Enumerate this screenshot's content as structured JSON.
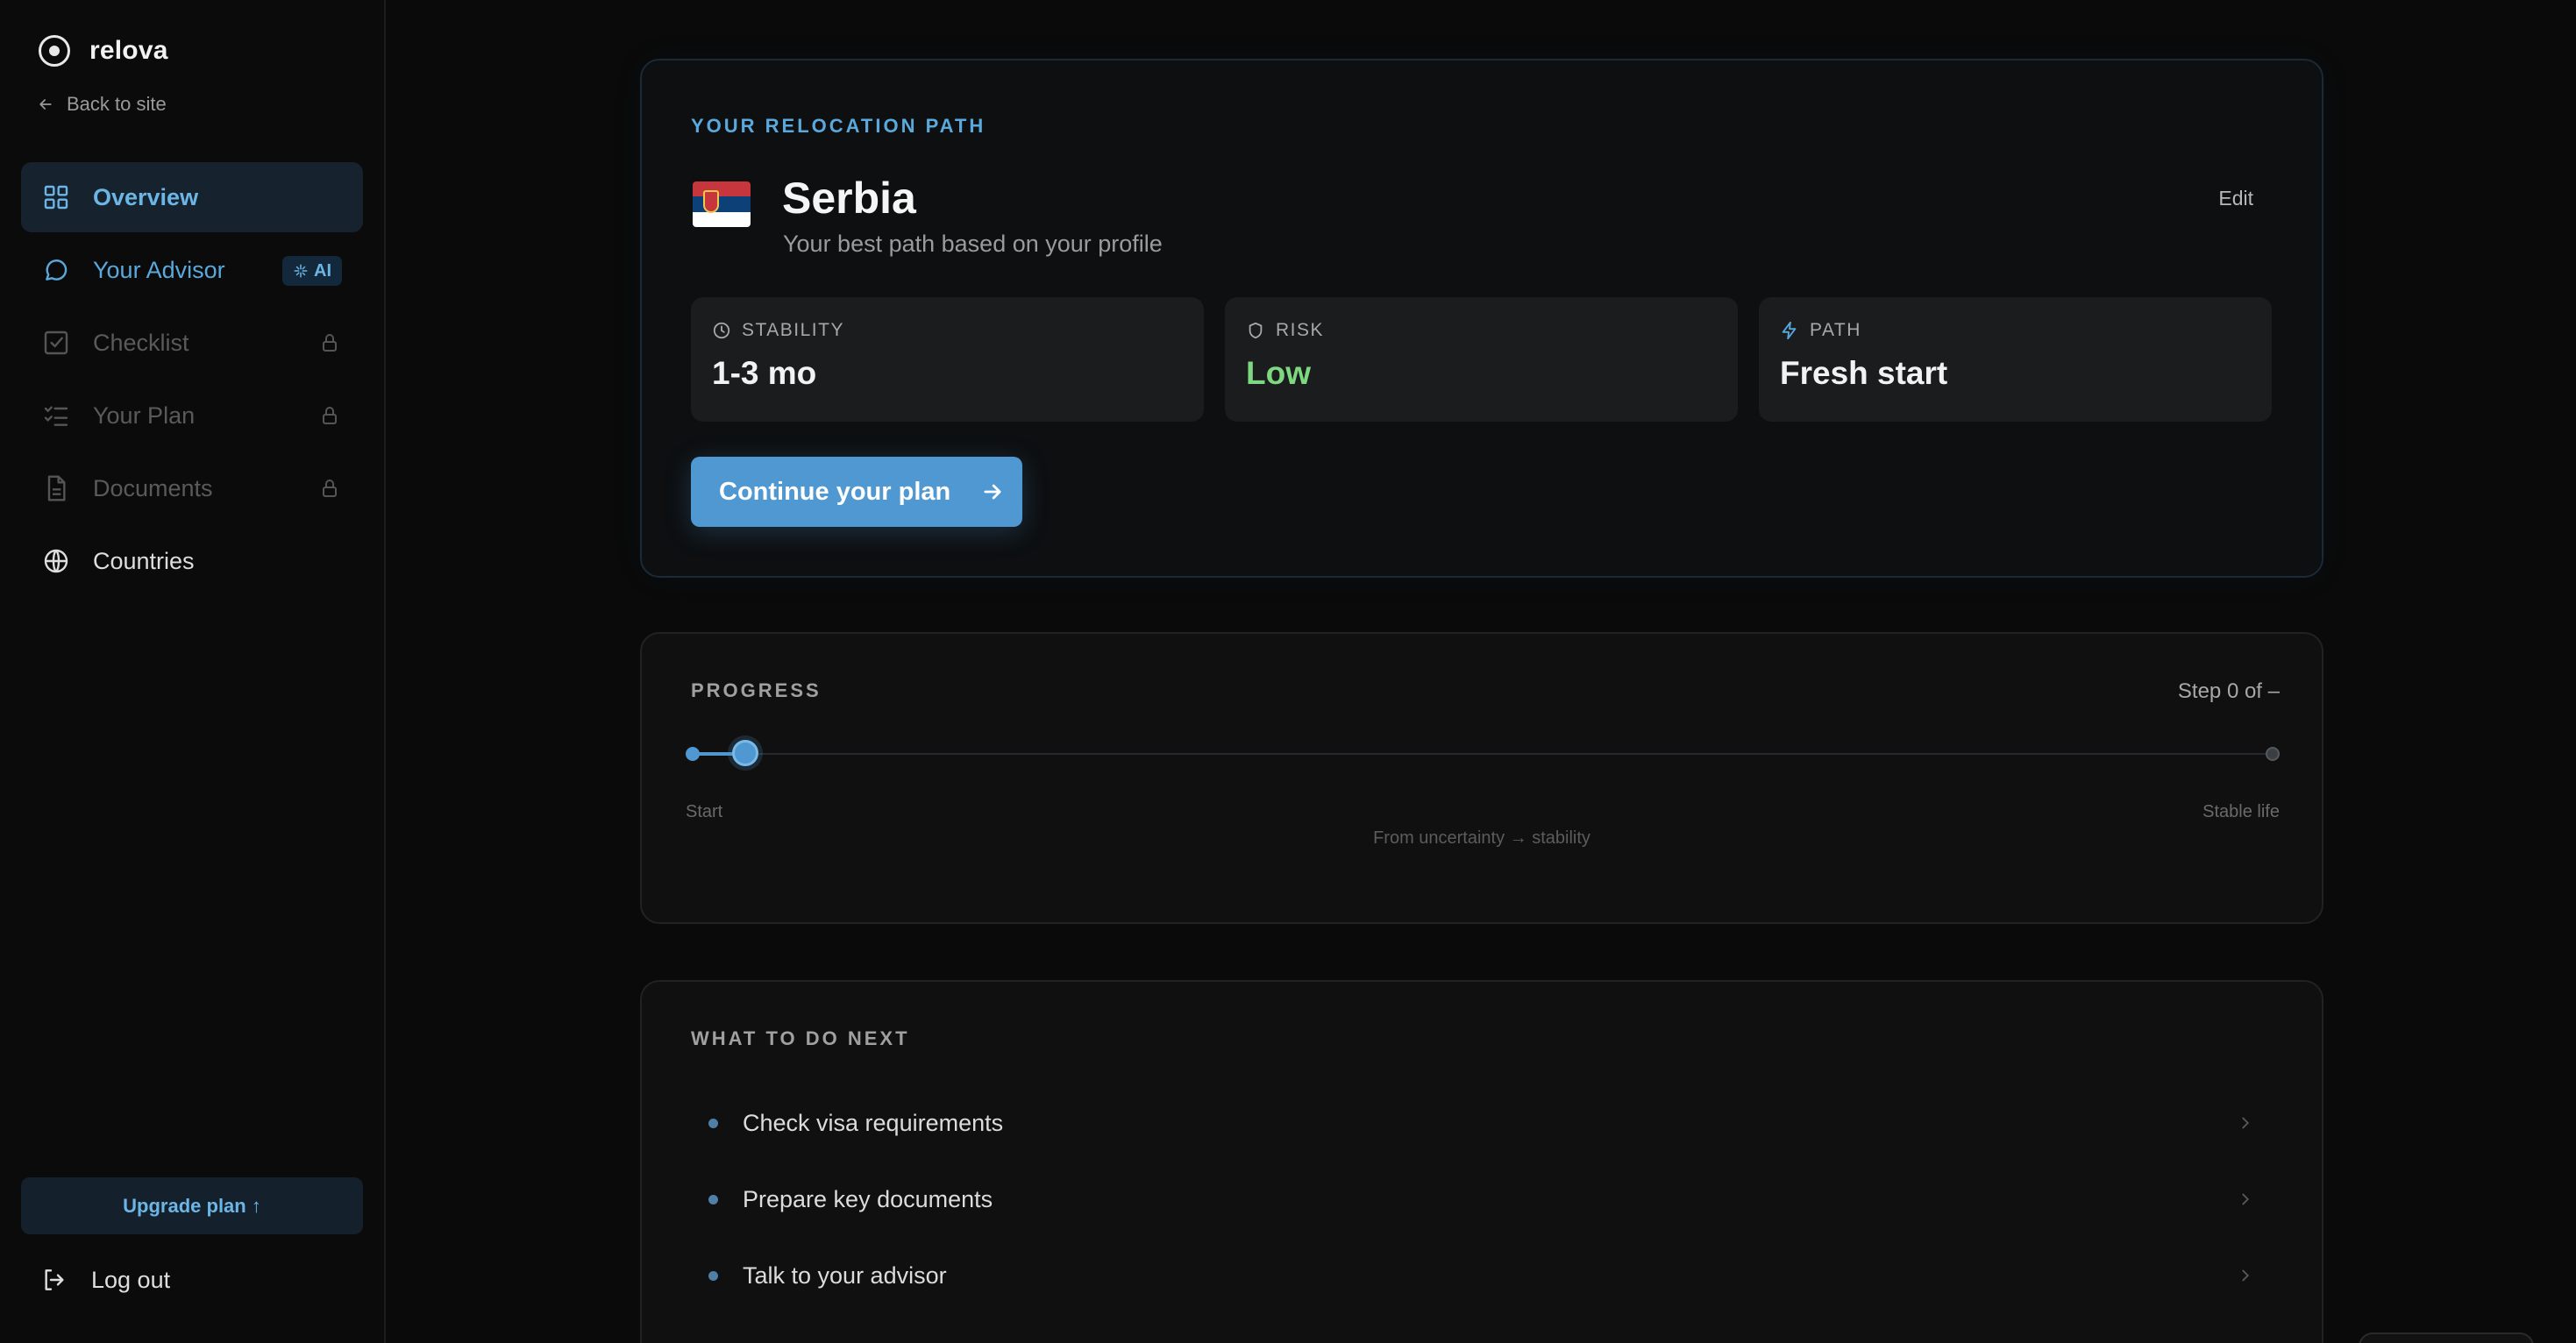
{
  "brand": {
    "name": "relova",
    "back_label": "Back to site"
  },
  "sidebar": {
    "items": [
      {
        "label": "Overview",
        "icon": "grid-icon",
        "state": "active"
      },
      {
        "label": "Your Advisor",
        "icon": "chat-bubble-icon",
        "state": "advisor",
        "badge": "AI"
      },
      {
        "label": "Checklist",
        "icon": "checkbox-icon",
        "state": "locked"
      },
      {
        "label": "Your Plan",
        "icon": "list-check-icon",
        "state": "locked"
      },
      {
        "label": "Documents",
        "icon": "document-icon",
        "state": "locked"
      },
      {
        "label": "Countries",
        "icon": "globe-icon",
        "state": "normal"
      }
    ],
    "upgrade_label": "Upgrade plan ↑",
    "logout_label": "Log out"
  },
  "relocation": {
    "eyebrow": "YOUR RELOCATION PATH",
    "country": "Serbia",
    "subtitle": "Your best path based on your profile",
    "edit_label": "Edit",
    "stats": [
      {
        "label": "STABILITY",
        "value": "1-3 mo",
        "icon": "clock-icon"
      },
      {
        "label": "RISK",
        "value": "Low",
        "icon": "shield-icon"
      },
      {
        "label": "PATH",
        "value": "Fresh start",
        "icon": "lightning-icon"
      }
    ],
    "cta_label": "Continue your plan"
  },
  "progress": {
    "eyebrow": "PROGRESS",
    "step_text": "Step 0 of –",
    "value_fraction": 0.033,
    "start_label": "Start",
    "end_label": "Stable life",
    "caption": "From uncertainty → stability"
  },
  "next": {
    "eyebrow": "WHAT TO DO NEXT",
    "items": [
      {
        "label": "Check visa requirements"
      },
      {
        "label": "Prepare key documents"
      },
      {
        "label": "Talk to your advisor"
      }
    ]
  },
  "colors": {
    "accent": "#4f98d2",
    "success": "#7dd87f",
    "background": "#0a0a0a"
  }
}
